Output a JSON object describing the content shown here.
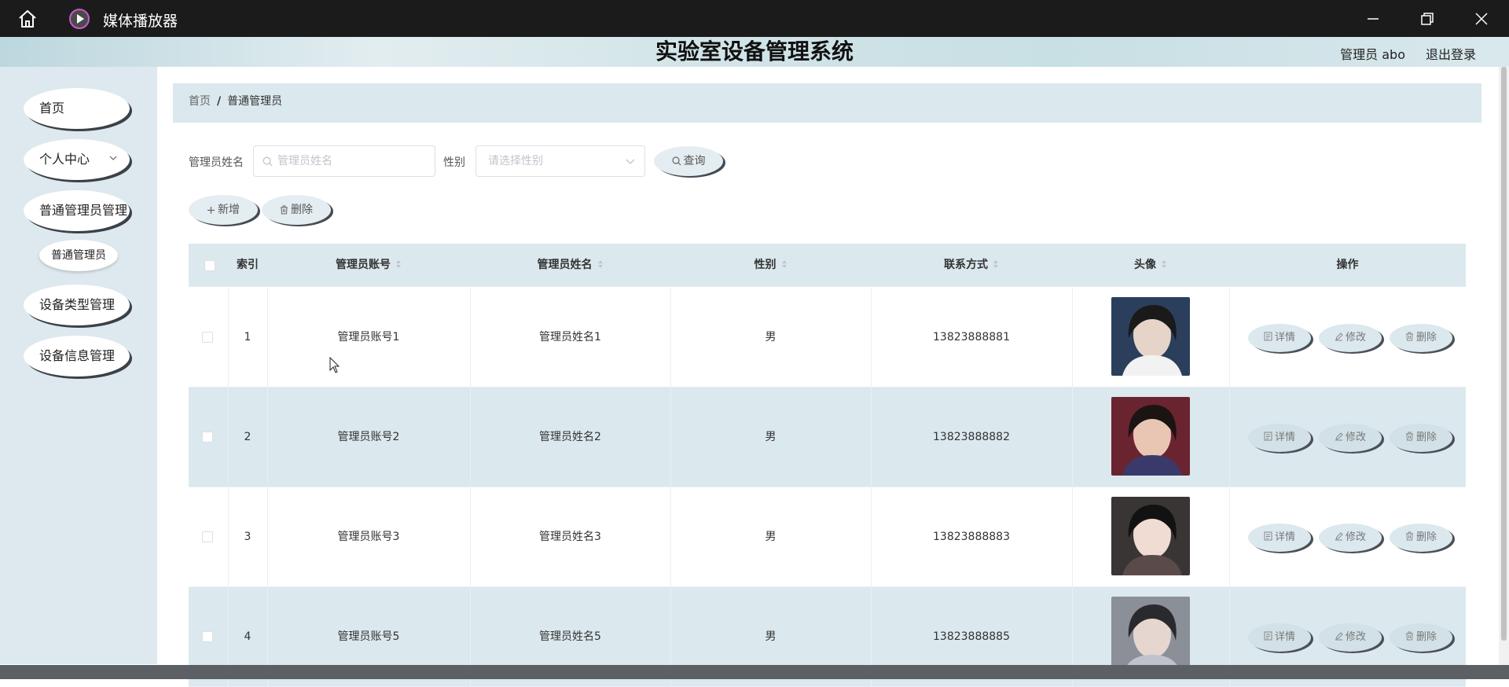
{
  "titlebar": {
    "app_title": "媒体播放器"
  },
  "header": {
    "system_title": "实验室设备管理系统",
    "user": "管理员 abo",
    "logout": "退出登录"
  },
  "sidebar": {
    "items": [
      {
        "label": "首页"
      },
      {
        "label": "个人中心"
      },
      {
        "label": "普通管理员管理"
      },
      {
        "label": "设备类型管理"
      },
      {
        "label": "设备信息管理"
      }
    ],
    "sub_item": "普通管理员"
  },
  "breadcrumb": {
    "home": "首页",
    "separator": "/",
    "current": "普通管理员"
  },
  "search": {
    "name_label": "管理员姓名",
    "name_placeholder": "管理员姓名",
    "gender_label": "性别",
    "gender_placeholder": "请选择性别",
    "query_button": "查询"
  },
  "actions": {
    "add": "新增",
    "delete": "删除"
  },
  "table": {
    "headers": {
      "index": "索引",
      "account": "管理员账号",
      "name": "管理员姓名",
      "gender": "性别",
      "phone": "联系方式",
      "avatar": "头像",
      "ops": "操作"
    },
    "rows": [
      {
        "index": "1",
        "account": "管理员账号1",
        "name": "管理员姓名1",
        "gender": "男",
        "phone": "13823888881"
      },
      {
        "index": "2",
        "account": "管理员账号2",
        "name": "管理员姓名2",
        "gender": "男",
        "phone": "13823888882"
      },
      {
        "index": "3",
        "account": "管理员账号3",
        "name": "管理员姓名3",
        "gender": "男",
        "phone": "13823888883"
      },
      {
        "index": "4",
        "account": "管理员账号5",
        "name": "管理员姓名5",
        "gender": "男",
        "phone": "13823888885"
      }
    ],
    "op_labels": {
      "detail": "详情",
      "edit": "修改",
      "delete": "删除"
    }
  }
}
